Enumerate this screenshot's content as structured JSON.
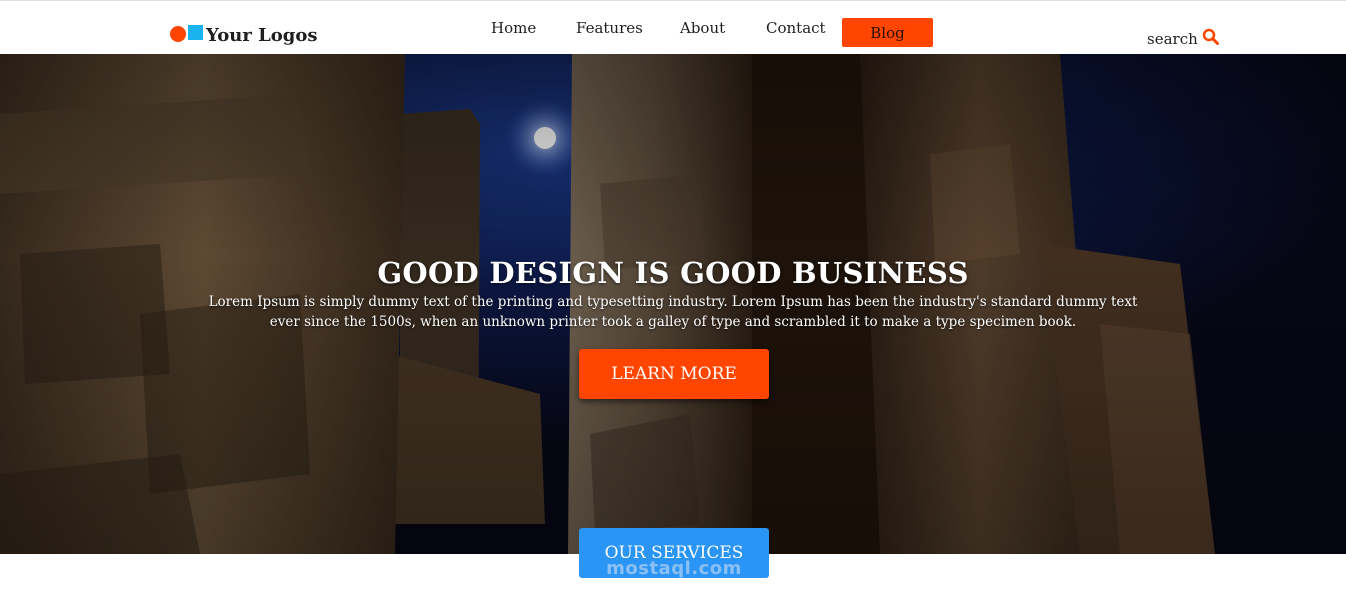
{
  "header": {
    "logo_text": "Your Logos",
    "colors": {
      "logo_circle": "#ff4500",
      "logo_square": "#1ab3f0",
      "accent": "#ff4500"
    },
    "nav": [
      {
        "label": "Home"
      },
      {
        "label": "Features"
      },
      {
        "label": "About"
      },
      {
        "label": "Contact"
      }
    ],
    "blog_label": "Blog",
    "search_label": "search",
    "search_icon": "search-icon"
  },
  "hero": {
    "title": "GOOD DESIGN IS GOOD BUSINESS",
    "text": "Lorem Ipsum is simply dummy text of the printing and typesetting industry. Lorem Ipsum has been the industry's standard dummy text ever since the 1500s, when an unknown printer took a galley of type and scrambled it to make a type specimen book.",
    "button_label": "LEARN MORE",
    "button_color": "#ff4500"
  },
  "services": {
    "button_label": "OUR SERVICES",
    "button_color": "#2b95f5"
  },
  "watermark": {
    "brand": "mostaql.com"
  }
}
